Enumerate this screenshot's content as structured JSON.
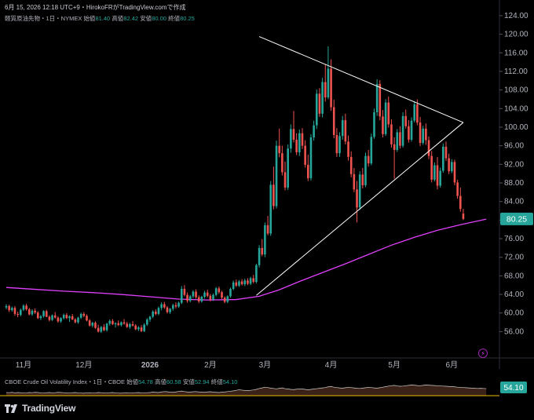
{
  "header": {
    "timestamp": "6月 15, 2026 12:18 UTC+9",
    "credit": "HirokoFRがTradingView.comで作成",
    "symbol": "軽質原油先物・1日・NYMEX",
    "open_label": "始値",
    "open": "81.40",
    "high_label": "高値",
    "high": "82.42",
    "low_label": "安値",
    "low": "80.00",
    "close_label": "終値",
    "close": "80.25"
  },
  "indicator": {
    "name": "CBOE Crude Oil Volatility Index・1日・CBOE",
    "open_label": "始値",
    "open": "54.78",
    "high_label": "高値",
    "high": "60.58",
    "low_label": "安値",
    "low": "52.94",
    "close_label": "終値",
    "close": "54.10",
    "badge": "54.10"
  },
  "logo": {
    "text": "TradingView",
    "icon": "tradingview-logo-icon"
  },
  "colors": {
    "up": "#26a69a",
    "down": "#ef5350",
    "ma": "#e040fb",
    "trend": "#ffffff",
    "badge": "#26a69a",
    "vol_line": "#ffffff",
    "vol_fill": "#4a2a1e"
  },
  "chart_data": {
    "type": "candlestick",
    "ylim": [
      51,
      125
    ],
    "y_ticks": [
      56,
      60,
      64,
      68,
      72,
      76,
      80,
      84,
      88,
      92,
      96,
      100,
      104,
      108,
      112,
      116,
      120,
      124
    ],
    "x_ticks": [
      {
        "label": "11月",
        "bar": 6
      },
      {
        "label": "12月",
        "bar": 27
      },
      {
        "label": "2026",
        "bar": 50
      },
      {
        "label": "2月",
        "bar": 71
      },
      {
        "label": "3月",
        "bar": 90
      },
      {
        "label": "4月",
        "bar": 113
      },
      {
        "label": "5月",
        "bar": 135
      },
      {
        "label": "6月",
        "bar": 155
      }
    ],
    "last_price": "80.25",
    "bar_count": 168,
    "candles": [
      [
        61.2,
        61.9,
        60.8,
        61.5
      ],
      [
        61.5,
        61.8,
        60.2,
        60.6
      ],
      [
        60.6,
        61.4,
        60.3,
        61.1
      ],
      [
        61.1,
        61.5,
        59.4,
        59.8
      ],
      [
        59.8,
        60.3,
        59.1,
        59.6
      ],
      [
        59.6,
        61.0,
        59.3,
        60.7
      ],
      [
        60.7,
        61.9,
        60.4,
        61.6
      ],
      [
        61.6,
        62.0,
        60.5,
        60.8
      ],
      [
        60.8,
        61.1,
        59.5,
        59.7
      ],
      [
        59.7,
        60.8,
        59.4,
        60.5
      ],
      [
        60.5,
        61.0,
        59.8,
        60.1
      ],
      [
        60.1,
        60.4,
        58.7,
        58.9
      ],
      [
        58.9,
        59.6,
        58.5,
        59.3
      ],
      [
        59.3,
        60.6,
        59.0,
        60.4
      ],
      [
        60.4,
        60.7,
        59.1,
        59.2
      ],
      [
        59.2,
        59.5,
        58.2,
        58.5
      ],
      [
        58.5,
        59.7,
        58.3,
        59.5
      ],
      [
        59.5,
        60.2,
        58.8,
        59.0
      ],
      [
        59.0,
        59.3,
        57.9,
        58.2
      ],
      [
        58.2,
        59.1,
        57.9,
        58.9
      ],
      [
        58.9,
        59.9,
        58.6,
        59.6
      ],
      [
        59.6,
        60.0,
        58.7,
        58.9
      ],
      [
        58.9,
        59.5,
        58.1,
        59.3
      ],
      [
        59.3,
        59.8,
        58.5,
        58.6
      ],
      [
        58.6,
        58.9,
        57.8,
        58.0
      ],
      [
        58.0,
        59.2,
        57.7,
        59.0
      ],
      [
        59.0,
        60.1,
        58.7,
        59.8
      ],
      [
        59.8,
        60.2,
        59.1,
        59.4
      ],
      [
        59.4,
        59.7,
        58.2,
        58.4
      ],
      [
        58.4,
        58.7,
        57.1,
        57.3
      ],
      [
        57.3,
        58.1,
        56.9,
        57.9
      ],
      [
        57.9,
        58.2,
        56.6,
        56.8
      ],
      [
        56.8,
        57.5,
        55.8,
        56.0
      ],
      [
        56.0,
        57.2,
        55.7,
        57.0
      ],
      [
        57.0,
        57.6,
        56.1,
        56.3
      ],
      [
        56.3,
        57.9,
        56.0,
        57.7
      ],
      [
        57.7,
        58.6,
        57.3,
        58.3
      ],
      [
        58.3,
        58.7,
        57.4,
        57.6
      ],
      [
        57.6,
        58.0,
        56.9,
        57.8
      ],
      [
        57.8,
        58.4,
        57.2,
        57.4
      ],
      [
        57.4,
        58.2,
        57.1,
        58.0
      ],
      [
        58.0,
        58.7,
        57.5,
        57.7
      ],
      [
        57.7,
        58.1,
        56.8,
        57.0
      ],
      [
        57.0,
        57.9,
        56.6,
        57.6
      ],
      [
        57.6,
        58.3,
        57.1,
        57.3
      ],
      [
        57.3,
        57.6,
        56.3,
        56.5
      ],
      [
        56.5,
        57.2,
        56.1,
        56.9
      ],
      [
        56.9,
        57.4,
        55.9,
        56.1
      ],
      [
        56.1,
        57.8,
        55.9,
        57.5
      ],
      [
        57.5,
        58.9,
        57.2,
        58.6
      ],
      [
        58.6,
        59.4,
        58.1,
        59.2
      ],
      [
        59.2,
        60.6,
        58.9,
        60.3
      ],
      [
        60.3,
        60.8,
        59.5,
        59.8
      ],
      [
        59.8,
        61.4,
        59.5,
        61.1
      ],
      [
        61.1,
        62.3,
        60.6,
        61.9
      ],
      [
        61.9,
        62.4,
        60.9,
        61.2
      ],
      [
        61.2,
        61.5,
        59.9,
        60.2
      ],
      [
        60.2,
        61.1,
        59.8,
        60.9
      ],
      [
        60.9,
        62.0,
        60.5,
        61.7
      ],
      [
        61.7,
        62.3,
        61.0,
        61.4
      ],
      [
        61.4,
        62.5,
        61.1,
        62.2
      ],
      [
        62.2,
        65.8,
        61.9,
        65.2
      ],
      [
        65.2,
        66.0,
        63.6,
        63.9
      ],
      [
        63.9,
        64.4,
        62.2,
        62.6
      ],
      [
        62.6,
        63.9,
        62.3,
        63.6
      ],
      [
        63.6,
        64.9,
        63.2,
        64.6
      ],
      [
        64.6,
        65.1,
        63.1,
        63.4
      ],
      [
        63.4,
        63.8,
        62.1,
        62.5
      ],
      [
        62.5,
        63.7,
        62.2,
        63.5
      ],
      [
        63.5,
        64.8,
        63.1,
        64.4
      ],
      [
        64.4,
        65.0,
        63.4,
        63.7
      ],
      [
        63.7,
        64.1,
        62.5,
        62.9
      ],
      [
        62.9,
        64.2,
        62.6,
        63.9
      ],
      [
        63.9,
        65.6,
        63.6,
        65.3
      ],
      [
        65.3,
        65.7,
        64.1,
        64.5
      ],
      [
        64.5,
        64.8,
        63.0,
        63.3
      ],
      [
        63.3,
        63.6,
        62.1,
        62.4
      ],
      [
        62.4,
        63.8,
        62.1,
        63.6
      ],
      [
        63.6,
        65.5,
        63.3,
        65.2
      ],
      [
        65.2,
        67.0,
        64.9,
        66.6
      ],
      [
        66.6,
        67.2,
        65.6,
        65.9
      ],
      [
        65.9,
        67.1,
        65.6,
        66.8
      ],
      [
        66.8,
        67.3,
        65.9,
        66.2
      ],
      [
        66.2,
        67.4,
        65.8,
        67.0
      ],
      [
        67.0,
        67.5,
        66.0,
        66.3
      ],
      [
        66.3,
        67.8,
        66.0,
        67.5
      ],
      [
        67.5,
        68.2,
        66.4,
        66.7
      ],
      [
        66.7,
        70.6,
        66.4,
        70.3
      ],
      [
        70.3,
        74.6,
        69.8,
        74.0
      ],
      [
        74.0,
        75.9,
        72.2,
        72.6
      ],
      [
        72.6,
        79.5,
        72.0,
        78.9
      ],
      [
        78.9,
        80.9,
        76.7,
        77.1
      ],
      [
        77.1,
        88.4,
        76.6,
        87.6
      ],
      [
        87.6,
        91.5,
        82.3,
        83.0
      ],
      [
        83.0,
        97.1,
        82.5,
        96.0
      ],
      [
        96.0,
        99.7,
        93.5,
        94.4
      ],
      [
        94.4,
        96.0,
        89.6,
        90.3
      ],
      [
        90.3,
        92.6,
        86.4,
        87.0
      ],
      [
        87.0,
        96.3,
        86.5,
        95.4
      ],
      [
        95.4,
        100.6,
        94.5,
        99.6
      ],
      [
        99.6,
        103.5,
        96.7,
        97.3
      ],
      [
        97.3,
        98.7,
        94.0,
        94.6
      ],
      [
        94.6,
        99.5,
        93.8,
        98.7
      ],
      [
        98.7,
        99.8,
        95.3,
        96.0
      ],
      [
        96.0,
        97.2,
        91.3,
        91.9
      ],
      [
        91.9,
        94.1,
        88.4,
        89.0
      ],
      [
        89.0,
        98.5,
        88.5,
        97.8
      ],
      [
        97.8,
        101.4,
        97.1,
        100.4
      ],
      [
        100.4,
        108.1,
        99.6,
        107.2
      ],
      [
        107.2,
        108.4,
        102.2,
        102.9
      ],
      [
        102.9,
        110.6,
        102.1,
        109.7
      ],
      [
        109.7,
        113.5,
        105.5,
        106.4
      ],
      [
        106.4,
        117.4,
        106.0,
        112.6
      ],
      [
        112.6,
        114.6,
        103.5,
        104.3
      ],
      [
        104.3,
        105.9,
        97.6,
        98.3
      ],
      [
        98.3,
        99.8,
        93.6,
        94.4
      ],
      [
        94.4,
        98.9,
        93.6,
        98.1
      ],
      [
        98.1,
        102.4,
        97.3,
        101.5
      ],
      [
        101.5,
        102.9,
        96.3,
        96.9
      ],
      [
        96.9,
        98.2,
        92.8,
        93.6
      ],
      [
        93.6,
        94.8,
        89.2,
        89.9
      ],
      [
        89.9,
        91.2,
        86.0,
        86.6
      ],
      [
        86.6,
        88.4,
        79.5,
        82.7
      ],
      [
        82.7,
        90.5,
        82.2,
        89.8
      ],
      [
        89.8,
        91.2,
        86.8,
        87.5
      ],
      [
        87.5,
        94.5,
        87.1,
        93.8
      ],
      [
        93.8,
        95.1,
        91.5,
        92.2
      ],
      [
        92.2,
        98.6,
        91.8,
        97.9
      ],
      [
        97.9,
        104.0,
        97.5,
        103.2
      ],
      [
        103.2,
        110.3,
        102.4,
        109.3
      ],
      [
        109.3,
        110.1,
        101.5,
        102.3
      ],
      [
        102.3,
        103.7,
        97.8,
        98.5
      ],
      [
        98.5,
        106.0,
        98.1,
        105.3
      ],
      [
        105.3,
        106.6,
        99.9,
        100.6
      ],
      [
        100.6,
        101.7,
        95.6,
        96.3
      ],
      [
        96.3,
        97.8,
        88.9,
        95.1
      ],
      [
        95.1,
        99.6,
        94.7,
        98.9
      ],
      [
        98.9,
        100.2,
        95.4,
        96.0
      ],
      [
        96.0,
        103.2,
        95.6,
        102.4
      ],
      [
        102.4,
        103.8,
        99.7,
        100.2
      ],
      [
        100.2,
        101.5,
        96.7,
        97.3
      ],
      [
        97.3,
        102.1,
        96.9,
        101.4
      ],
      [
        101.4,
        105.6,
        101.0,
        104.9
      ],
      [
        104.9,
        106.0,
        100.4,
        101.0
      ],
      [
        101.0,
        102.2,
        95.9,
        96.6
      ],
      [
        96.6,
        100.3,
        96.2,
        99.7
      ],
      [
        99.7,
        100.8,
        96.2,
        97.2
      ],
      [
        97.2,
        98.0,
        93.1,
        93.8
      ],
      [
        93.8,
        94.9,
        88.1,
        88.7
      ],
      [
        88.7,
        92.4,
        88.3,
        91.8
      ],
      [
        91.8,
        93.6,
        86.6,
        87.4
      ],
      [
        87.4,
        91.3,
        87.0,
        90.6
      ],
      [
        90.6,
        96.5,
        90.2,
        95.8
      ],
      [
        95.8,
        96.9,
        92.7,
        93.3
      ],
      [
        93.3,
        94.3,
        89.9,
        90.5
      ],
      [
        90.5,
        93.1,
        90.1,
        92.5
      ],
      [
        92.5,
        93.0,
        87.5,
        88.1
      ],
      [
        88.1,
        88.7,
        84.6,
        85.2
      ],
      [
        85.2,
        87.0,
        81.8,
        82.4
      ],
      [
        81.4,
        82.42,
        80.0,
        80.25
      ]
    ],
    "ma": [
      [
        0,
        65.5
      ],
      [
        10,
        65.1
      ],
      [
        20,
        64.7
      ],
      [
        30,
        64.4
      ],
      [
        40,
        64.0
      ],
      [
        50,
        63.5
      ],
      [
        60,
        63.0
      ],
      [
        70,
        62.8
      ],
      [
        80,
        62.9
      ],
      [
        88,
        63.6
      ],
      [
        95,
        65.0
      ],
      [
        102,
        66.8
      ],
      [
        110,
        68.7
      ],
      [
        118,
        70.6
      ],
      [
        126,
        72.6
      ],
      [
        134,
        74.6
      ],
      [
        142,
        76.3
      ],
      [
        150,
        77.8
      ],
      [
        158,
        79.0
      ],
      [
        167,
        80.2
      ]
    ],
    "trendlines": [
      {
        "from": [
          88,
          119.5
        ],
        "to": [
          159,
          101.0
        ]
      },
      {
        "from": [
          87,
          63.8
        ],
        "to": [
          159,
          101.0
        ]
      }
    ],
    "volatility_series": [
      33,
      32,
      34,
      31,
      33,
      32,
      30,
      31,
      33,
      32,
      34,
      33,
      31,
      30,
      32,
      33,
      31,
      32,
      34,
      33,
      32,
      31,
      30,
      32,
      33,
      31,
      30,
      29,
      31,
      32,
      30,
      31,
      33,
      32,
      31,
      30,
      32,
      33,
      31,
      30,
      29,
      31,
      32,
      30,
      31,
      32,
      33,
      31,
      30,
      32,
      33,
      35,
      34,
      33,
      36,
      38,
      37,
      35,
      34,
      36,
      39,
      41,
      38,
      36,
      35,
      37,
      38,
      36,
      35,
      34,
      36,
      37,
      35,
      34,
      33,
      35,
      36,
      38,
      40,
      42,
      45,
      48,
      46,
      44,
      43,
      45,
      47,
      50,
      55,
      58,
      62,
      60,
      57,
      55,
      53,
      56,
      58,
      54,
      52,
      50,
      49,
      51,
      53,
      52,
      50,
      48,
      50,
      52,
      54,
      56,
      58,
      60,
      64,
      66,
      62,
      60,
      58,
      57,
      59,
      61,
      60,
      58,
      56,
      55,
      57,
      59,
      61,
      60,
      58,
      57,
      59,
      62,
      65,
      68,
      70,
      72,
      69,
      67,
      68,
      70,
      72,
      74,
      73,
      71,
      70,
      72,
      74,
      73,
      72,
      71,
      70,
      69,
      68,
      67,
      66,
      65,
      64,
      62,
      61,
      60,
      59,
      58,
      57,
      56,
      55,
      56,
      55,
      54.1
    ]
  }
}
